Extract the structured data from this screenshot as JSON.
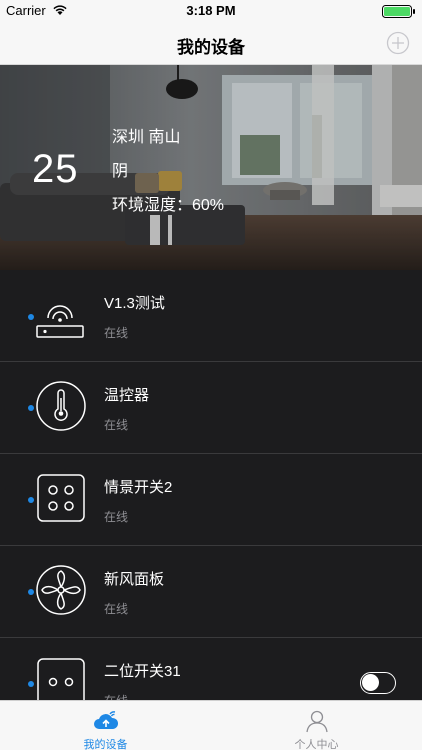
{
  "status_bar": {
    "carrier": "Carrier",
    "time": "3:18 PM"
  },
  "nav": {
    "title": "我的设备"
  },
  "hero": {
    "temperature": "25",
    "city": "深圳 南山",
    "weather": "阴",
    "humidity": "环境湿度：60%"
  },
  "devices": [
    {
      "name": "V1.3测试",
      "state": "在线",
      "icon": "gateway-icon"
    },
    {
      "name": "温控器",
      "state": "在线",
      "icon": "thermometer-icon"
    },
    {
      "name": "情景开关2",
      "state": "在线",
      "icon": "four-button-switch-icon"
    },
    {
      "name": "新风面板",
      "state": "在线",
      "icon": "fan-icon"
    },
    {
      "name": "二位开关31",
      "state": "在线",
      "icon": "two-button-switch-icon",
      "toggle_on": false
    }
  ],
  "tabs": [
    {
      "label": "我的设备",
      "icon": "cloud-devices-icon",
      "active": true
    },
    {
      "label": "个人中心",
      "icon": "person-icon",
      "active": false
    }
  ],
  "colors": {
    "accent": "#1e88e5",
    "list_bg": "#1c1c1e",
    "bar_bg": "#f7f7f7",
    "inactive_tab": "#8e8e93"
  }
}
